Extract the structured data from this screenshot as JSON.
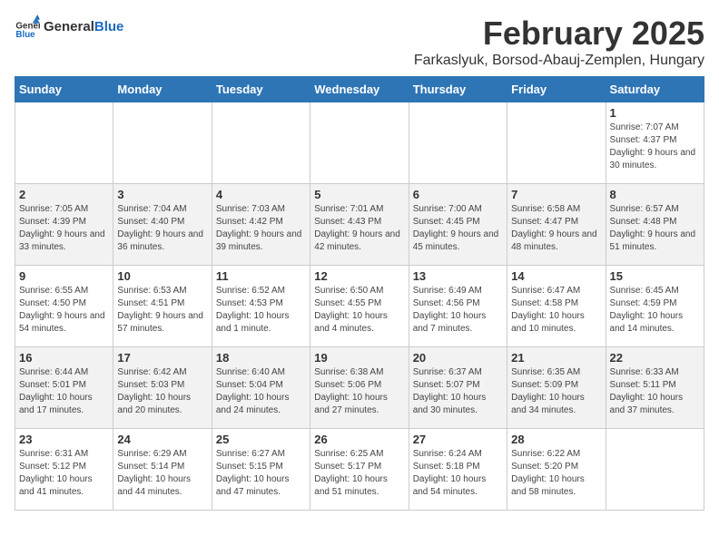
{
  "header": {
    "logo_general": "General",
    "logo_blue": "Blue",
    "month_title": "February 2025",
    "location": "Farkaslyuk, Borsod-Abauj-Zemplen, Hungary"
  },
  "weekdays": [
    "Sunday",
    "Monday",
    "Tuesday",
    "Wednesday",
    "Thursday",
    "Friday",
    "Saturday"
  ],
  "weeks": [
    [
      {
        "day": "",
        "info": ""
      },
      {
        "day": "",
        "info": ""
      },
      {
        "day": "",
        "info": ""
      },
      {
        "day": "",
        "info": ""
      },
      {
        "day": "",
        "info": ""
      },
      {
        "day": "",
        "info": ""
      },
      {
        "day": "1",
        "info": "Sunrise: 7:07 AM\nSunset: 4:37 PM\nDaylight: 9 hours and 30 minutes."
      }
    ],
    [
      {
        "day": "2",
        "info": "Sunrise: 7:05 AM\nSunset: 4:39 PM\nDaylight: 9 hours and 33 minutes."
      },
      {
        "day": "3",
        "info": "Sunrise: 7:04 AM\nSunset: 4:40 PM\nDaylight: 9 hours and 36 minutes."
      },
      {
        "day": "4",
        "info": "Sunrise: 7:03 AM\nSunset: 4:42 PM\nDaylight: 9 hours and 39 minutes."
      },
      {
        "day": "5",
        "info": "Sunrise: 7:01 AM\nSunset: 4:43 PM\nDaylight: 9 hours and 42 minutes."
      },
      {
        "day": "6",
        "info": "Sunrise: 7:00 AM\nSunset: 4:45 PM\nDaylight: 9 hours and 45 minutes."
      },
      {
        "day": "7",
        "info": "Sunrise: 6:58 AM\nSunset: 4:47 PM\nDaylight: 9 hours and 48 minutes."
      },
      {
        "day": "8",
        "info": "Sunrise: 6:57 AM\nSunset: 4:48 PM\nDaylight: 9 hours and 51 minutes."
      }
    ],
    [
      {
        "day": "9",
        "info": "Sunrise: 6:55 AM\nSunset: 4:50 PM\nDaylight: 9 hours and 54 minutes."
      },
      {
        "day": "10",
        "info": "Sunrise: 6:53 AM\nSunset: 4:51 PM\nDaylight: 9 hours and 57 minutes."
      },
      {
        "day": "11",
        "info": "Sunrise: 6:52 AM\nSunset: 4:53 PM\nDaylight: 10 hours and 1 minute."
      },
      {
        "day": "12",
        "info": "Sunrise: 6:50 AM\nSunset: 4:55 PM\nDaylight: 10 hours and 4 minutes."
      },
      {
        "day": "13",
        "info": "Sunrise: 6:49 AM\nSunset: 4:56 PM\nDaylight: 10 hours and 7 minutes."
      },
      {
        "day": "14",
        "info": "Sunrise: 6:47 AM\nSunset: 4:58 PM\nDaylight: 10 hours and 10 minutes."
      },
      {
        "day": "15",
        "info": "Sunrise: 6:45 AM\nSunset: 4:59 PM\nDaylight: 10 hours and 14 minutes."
      }
    ],
    [
      {
        "day": "16",
        "info": "Sunrise: 6:44 AM\nSunset: 5:01 PM\nDaylight: 10 hours and 17 minutes."
      },
      {
        "day": "17",
        "info": "Sunrise: 6:42 AM\nSunset: 5:03 PM\nDaylight: 10 hours and 20 minutes."
      },
      {
        "day": "18",
        "info": "Sunrise: 6:40 AM\nSunset: 5:04 PM\nDaylight: 10 hours and 24 minutes."
      },
      {
        "day": "19",
        "info": "Sunrise: 6:38 AM\nSunset: 5:06 PM\nDaylight: 10 hours and 27 minutes."
      },
      {
        "day": "20",
        "info": "Sunrise: 6:37 AM\nSunset: 5:07 PM\nDaylight: 10 hours and 30 minutes."
      },
      {
        "day": "21",
        "info": "Sunrise: 6:35 AM\nSunset: 5:09 PM\nDaylight: 10 hours and 34 minutes."
      },
      {
        "day": "22",
        "info": "Sunrise: 6:33 AM\nSunset: 5:11 PM\nDaylight: 10 hours and 37 minutes."
      }
    ],
    [
      {
        "day": "23",
        "info": "Sunrise: 6:31 AM\nSunset: 5:12 PM\nDaylight: 10 hours and 41 minutes."
      },
      {
        "day": "24",
        "info": "Sunrise: 6:29 AM\nSunset: 5:14 PM\nDaylight: 10 hours and 44 minutes."
      },
      {
        "day": "25",
        "info": "Sunrise: 6:27 AM\nSunset: 5:15 PM\nDaylight: 10 hours and 47 minutes."
      },
      {
        "day": "26",
        "info": "Sunrise: 6:25 AM\nSunset: 5:17 PM\nDaylight: 10 hours and 51 minutes."
      },
      {
        "day": "27",
        "info": "Sunrise: 6:24 AM\nSunset: 5:18 PM\nDaylight: 10 hours and 54 minutes."
      },
      {
        "day": "28",
        "info": "Sunrise: 6:22 AM\nSunset: 5:20 PM\nDaylight: 10 hours and 58 minutes."
      },
      {
        "day": "",
        "info": ""
      }
    ]
  ]
}
